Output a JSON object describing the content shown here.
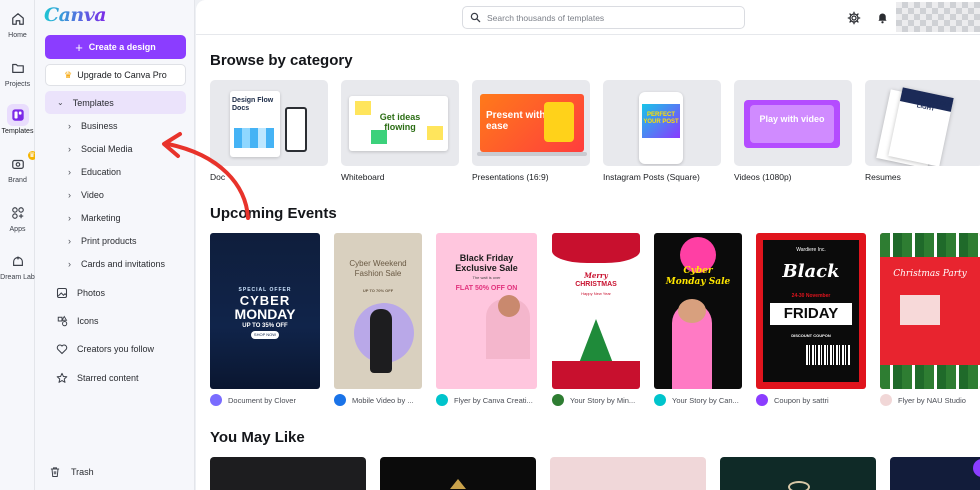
{
  "rail": [
    {
      "label": "Home",
      "icon": "home-icon"
    },
    {
      "label": "Projects",
      "icon": "folder-icon"
    },
    {
      "label": "Templates",
      "icon": "templates-icon"
    },
    {
      "label": "Brand",
      "icon": "brand-icon"
    },
    {
      "label": "Apps",
      "icon": "apps-icon"
    },
    {
      "label": "Dream Lab",
      "icon": "dream-lab-icon"
    }
  ],
  "panel": {
    "logo": "Canva",
    "create_label": "Create a design",
    "upgrade_label": "Upgrade to Canva Pro",
    "templates_label": "Templates",
    "template_items": [
      "Business",
      "Social Media",
      "Education",
      "Video",
      "Marketing",
      "Print products",
      "Cards and invitations"
    ],
    "nav": [
      "Photos",
      "Icons",
      "Creators you follow",
      "Starred content"
    ],
    "trash_label": "Trash"
  },
  "search": {
    "placeholder": "Search thousands of templates"
  },
  "sections": {
    "browse": "Browse by category",
    "events": "Upcoming Events",
    "like": "You May Like"
  },
  "categories": [
    {
      "label": "Doc",
      "thumb_text": "Design Flow Docs"
    },
    {
      "label": "Whiteboard",
      "thumb_text": "Get ideas flowing"
    },
    {
      "label": "Presentations (16:9)",
      "thumb_text": "Present with ease"
    },
    {
      "label": "Instagram Posts (Square)",
      "thumb_text": "PERFECT YOUR POST"
    },
    {
      "label": "Videos (1080p)",
      "thumb_text": "Play with video"
    },
    {
      "label": "Resumes",
      "thumb_text": "STAND OUT LIGHT"
    }
  ],
  "events": [
    {
      "meta": "Document by Clover",
      "line1": "SPECIAL OFFER",
      "line2": "CYBER",
      "line3": "MONDAY",
      "line4": "UP TO 35% OFF",
      "line5": "SHOP NOW"
    },
    {
      "meta": "Mobile Video by ...",
      "line1": "Cyber Weekend",
      "line2": "Fashion Sale",
      "line3": "UP TO 70% OFF"
    },
    {
      "meta": "Flyer by Canva Creati...",
      "line1": "Black Friday",
      "line2": "Exclusive Sale",
      "line3": "The wait is over",
      "line4": "FLAT 50% OFF ON"
    },
    {
      "meta": "Your Story by Min...",
      "line1": "Merry",
      "line2": "CHRISTMAS",
      "line3": "Happy New Year"
    },
    {
      "meta": "Your Story by Can...",
      "line1": "Cyber",
      "line2": "Monday Sale"
    },
    {
      "meta": "Coupon by sattri",
      "line1": "Wardiere Inc.",
      "line2": "Black",
      "line3": "24-30 November",
      "line4": "FRIDAY",
      "line5": "DISCOUNT COUPON"
    },
    {
      "meta": "Flyer by NAU Studio",
      "line1": "Christmas Party"
    }
  ],
  "colors": {
    "accent": "#8b3dff",
    "annotation_arrow": "#e8332b"
  }
}
